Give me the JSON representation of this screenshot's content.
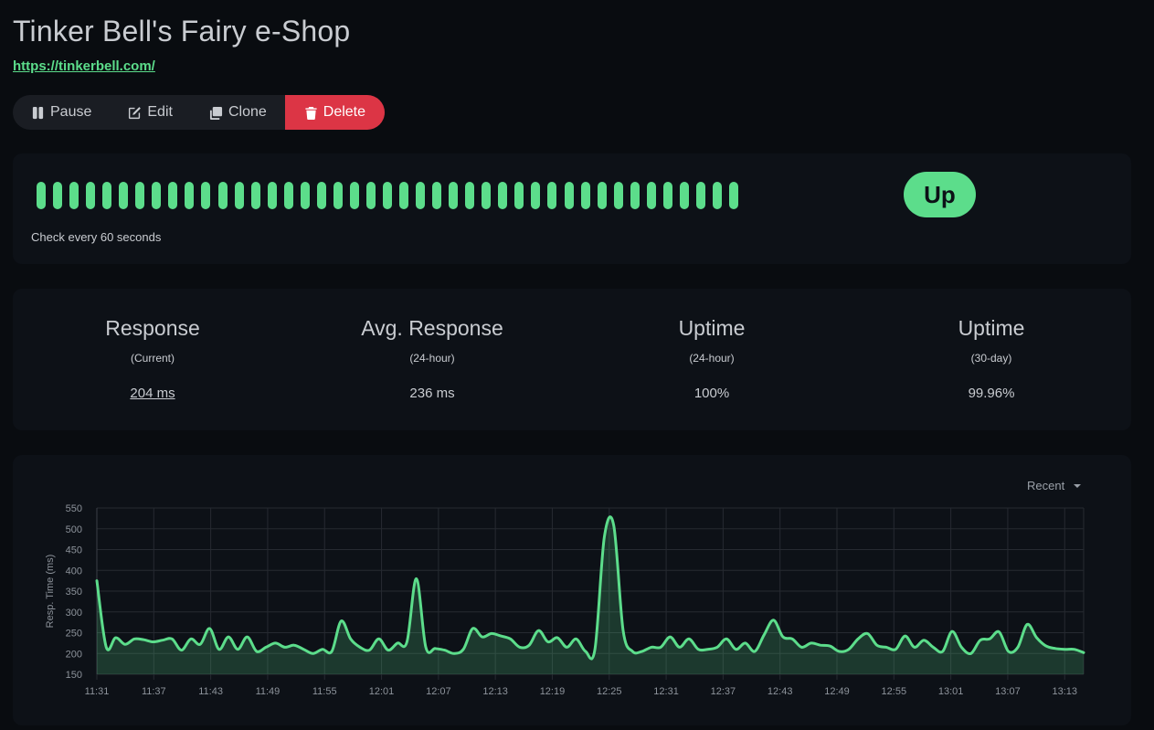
{
  "header": {
    "title": "Tinker Bell's Fairy e-Shop",
    "url": "https://tinkerbell.com/"
  },
  "toolbar": {
    "pause_label": "Pause",
    "edit_label": "Edit",
    "clone_label": "Clone",
    "delete_label": "Delete"
  },
  "heartbeat": {
    "beat_count": 43,
    "check_text": "Check every 60 seconds",
    "status": "Up"
  },
  "stats": [
    {
      "title": "Response",
      "sub": "(Current)",
      "value": "204 ms"
    },
    {
      "title": "Avg. Response",
      "sub": "(24-hour)",
      "value": "236 ms"
    },
    {
      "title": "Uptime",
      "sub": "(24-hour)",
      "value": "100%"
    },
    {
      "title": "Uptime",
      "sub": "(30-day)",
      "value": "99.96%"
    }
  ],
  "chart_controls": {
    "period": "Recent"
  },
  "colors": {
    "up": "#5cdd8b",
    "delete": "#dc3545",
    "background": "#090c10",
    "card": "#0d1117"
  },
  "chart_data": {
    "type": "area",
    "ylabel": "Resp. Time (ms)",
    "ylim": [
      150,
      550
    ],
    "yticks": [
      150,
      200,
      250,
      300,
      350,
      400,
      450,
      500,
      550
    ],
    "xlim": [
      "11:31",
      "13:15"
    ],
    "xticks": [
      "11:31",
      "11:37",
      "11:43",
      "11:49",
      "11:55",
      "12:01",
      "12:07",
      "12:13",
      "12:19",
      "12:25",
      "12:31",
      "12:37",
      "12:43",
      "12:49",
      "12:55",
      "13:01",
      "13:07",
      "13:13"
    ],
    "grid": true,
    "series": [
      {
        "color": "#5cdd8b",
        "values": [
          375,
          215,
          238,
          222,
          235,
          233,
          228,
          232,
          235,
          208,
          235,
          222,
          260,
          210,
          240,
          210,
          240,
          205,
          215,
          225,
          215,
          220,
          210,
          200,
          210,
          205,
          278,
          235,
          215,
          208,
          235,
          208,
          225,
          228,
          380,
          215,
          212,
          208,
          200,
          210,
          260,
          240,
          248,
          242,
          235,
          215,
          220,
          255,
          228,
          238,
          215,
          235,
          205,
          210,
          480,
          508,
          255,
          205,
          205,
          215,
          215,
          240,
          215,
          235,
          210,
          210,
          215,
          235,
          210,
          225,
          205,
          245,
          280,
          240,
          235,
          215,
          225,
          220,
          218,
          205,
          210,
          235,
          248,
          220,
          215,
          210,
          242,
          215,
          232,
          215,
          205,
          253,
          215,
          200,
          232,
          235,
          252,
          205,
          215,
          270,
          238,
          218,
          212,
          210,
          210,
          202
        ]
      }
    ]
  }
}
